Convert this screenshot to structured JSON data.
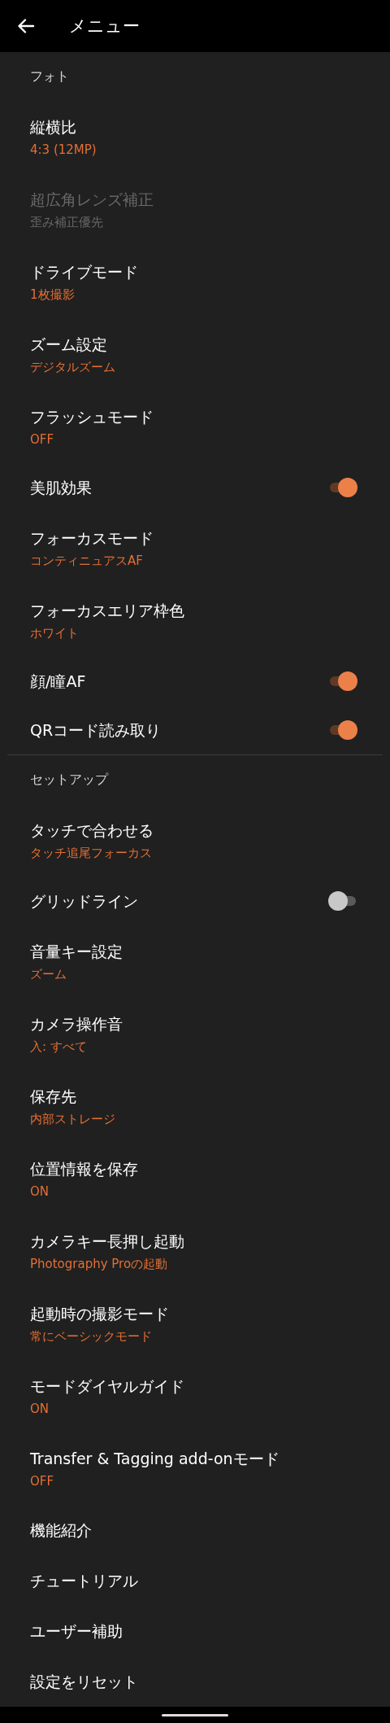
{
  "app_bar": {
    "title": "メニュー"
  },
  "sections": [
    {
      "title": "フォト",
      "items": [
        {
          "kind": "value",
          "title": "縦横比",
          "value": "4:3 (12MP)",
          "disabled": false
        },
        {
          "kind": "value",
          "title": "超広角レンズ補正",
          "value": "歪み補正優先",
          "disabled": true
        },
        {
          "kind": "value",
          "title": "ドライブモード",
          "value": "1枚撮影",
          "disabled": false
        },
        {
          "kind": "value",
          "title": "ズーム設定",
          "value": "デジタルズーム",
          "disabled": false
        },
        {
          "kind": "value",
          "title": "フラッシュモード",
          "value": "OFF",
          "disabled": false
        },
        {
          "kind": "toggle",
          "title": "美肌効果",
          "on": true,
          "disabled": false
        },
        {
          "kind": "value",
          "title": "フォーカスモード",
          "value": "コンティニュアスAF",
          "disabled": false
        },
        {
          "kind": "value",
          "title": "フォーカスエリア枠色",
          "value": "ホワイト",
          "disabled": false
        },
        {
          "kind": "toggle",
          "title": "顔/瞳AF",
          "on": true,
          "disabled": false
        },
        {
          "kind": "toggle",
          "title": "QRコード読み取り",
          "on": true,
          "disabled": false
        }
      ]
    },
    {
      "title": "セットアップ",
      "items": [
        {
          "kind": "value",
          "title": "タッチで合わせる",
          "value": "タッチ追尾フォーカス",
          "disabled": false
        },
        {
          "kind": "toggle",
          "title": "グリッドライン",
          "on": false,
          "disabled": false
        },
        {
          "kind": "value",
          "title": "音量キー設定",
          "value": "ズーム",
          "disabled": false
        },
        {
          "kind": "value",
          "title": "カメラ操作音",
          "value": "入: すべて",
          "disabled": false
        },
        {
          "kind": "value",
          "title": "保存先",
          "value": "内部ストレージ",
          "disabled": false
        },
        {
          "kind": "value",
          "title": "位置情報を保存",
          "value": "ON",
          "disabled": false
        },
        {
          "kind": "value",
          "title": "カメラキー長押し起動",
          "value": "Photography Proの起動",
          "disabled": false
        },
        {
          "kind": "value",
          "title": "起動時の撮影モード",
          "value": "常にベーシックモード",
          "disabled": false
        },
        {
          "kind": "value",
          "title": "モードダイヤルガイド",
          "value": "ON",
          "disabled": false
        },
        {
          "kind": "value",
          "title": "Transfer & Tagging add-onモード",
          "value": "OFF",
          "disabled": false
        },
        {
          "kind": "plain",
          "title": "機能紹介",
          "disabled": false
        },
        {
          "kind": "plain",
          "title": "チュートリアル",
          "disabled": false
        },
        {
          "kind": "plain",
          "title": "ユーザー補助",
          "disabled": false
        },
        {
          "kind": "plain",
          "title": "設定をリセット",
          "disabled": false
        }
      ]
    }
  ]
}
